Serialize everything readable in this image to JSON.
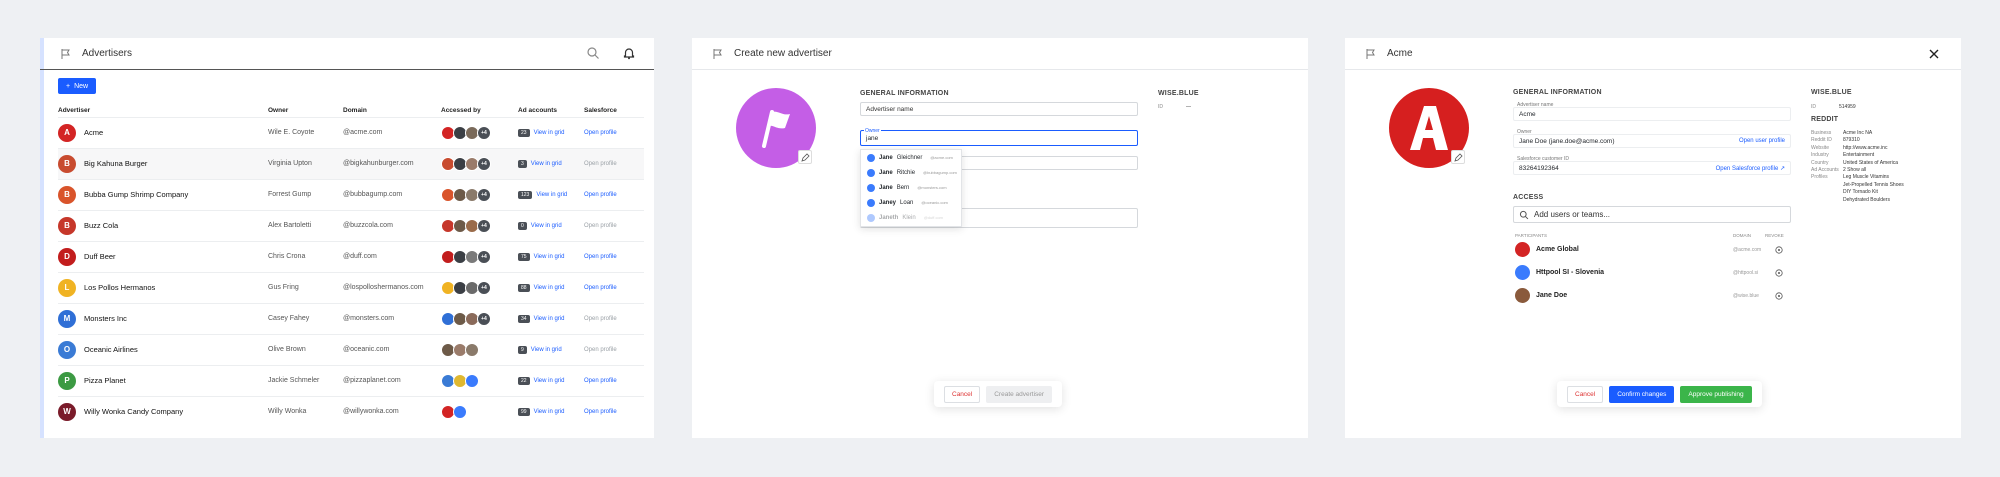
{
  "panel1": {
    "title": "Advertisers",
    "new_button": "New",
    "columns": [
      "Advertiser",
      "Owner",
      "Domain",
      "Accessed by",
      "Ad accounts",
      "Salesforce"
    ],
    "rows": [
      {
        "name": "Acme",
        "owner": "Wile E. Coyote",
        "domain": "@acme.com",
        "count": "23",
        "grid": "View in grid",
        "profile": "Open profile",
        "profile_active": true,
        "logo_color": "#d32424",
        "logo_letter": "A"
      },
      {
        "name": "Big Kahuna Burger",
        "owner": "Virginia Upton",
        "domain": "@bigkahunburger.com",
        "count": "3",
        "grid": "View in grid",
        "profile": "Open profile",
        "profile_active": false,
        "logo_color": "#c84b2f",
        "logo_letter": "B"
      },
      {
        "name": "Bubba Gump Shrimp Company",
        "owner": "Forrest Gump",
        "domain": "@bubbagump.com",
        "count": "123",
        "grid": "View in grid",
        "profile": "Open profile",
        "profile_active": true,
        "logo_color": "#d9542b",
        "logo_letter": "B"
      },
      {
        "name": "Buzz Cola",
        "owner": "Alex Bartoletti",
        "domain": "@buzzcola.com",
        "count": "0",
        "grid": "View in grid",
        "profile": "Open profile",
        "profile_active": false,
        "logo_color": "#c6372a",
        "logo_letter": "B"
      },
      {
        "name": "Duff Beer",
        "owner": "Chris Crona",
        "domain": "@duff.com",
        "count": "75",
        "grid": "View in grid",
        "profile": "Open profile",
        "profile_active": true,
        "logo_color": "#c21d1d",
        "logo_letter": "D"
      },
      {
        "name": "Los Pollos Hermanos",
        "owner": "Gus Fring",
        "domain": "@lospolloshermanos.com",
        "count": "88",
        "grid": "View in grid",
        "profile": "Open profile",
        "profile_active": true,
        "logo_color": "#f0b323",
        "logo_letter": "L"
      },
      {
        "name": "Monsters Inc",
        "owner": "Casey Fahey",
        "domain": "@monsters.com",
        "count": "34",
        "grid": "View in grid",
        "profile": "Open profile",
        "profile_active": false,
        "logo_color": "#2f6fd6",
        "logo_letter": "M"
      },
      {
        "name": "Oceanic Airlines",
        "owner": "Olive Brown",
        "domain": "@oceanic.com",
        "count": "9",
        "grid": "View in grid",
        "profile": "Open profile",
        "profile_active": false,
        "logo_color": "#3a7bd5",
        "logo_letter": "O"
      },
      {
        "name": "Pizza Planet",
        "owner": "Jackie Schmeler",
        "domain": "@pizzaplanet.com",
        "count": "22",
        "grid": "View in grid",
        "profile": "Open profile",
        "profile_active": true,
        "logo_color": "#3c9a43",
        "logo_letter": "P"
      },
      {
        "name": "Willy Wonka Candy Company",
        "owner": "Willy Wonka",
        "domain": "@willywonka.com",
        "count": "99",
        "grid": "View in grid",
        "profile": "Open profile",
        "profile_active": true,
        "logo_color": "#7a1b2a",
        "logo_letter": "W"
      }
    ],
    "more_badge": "+4"
  },
  "panel2": {
    "title": "Create new advertiser",
    "general_info": "GENERAL INFORMATION",
    "name_placeholder": "Advertiser name",
    "owner_label": "Owner",
    "owner_value": "jane",
    "dropdown": [
      {
        "first": "Jane",
        "last": "Gleichner",
        "email": "@acme.com"
      },
      {
        "first": "Jane",
        "last": "Ritchie",
        "email": "@bubbagump.com"
      },
      {
        "first": "Jane",
        "last": "Bern",
        "email": "@monsters.com"
      },
      {
        "first": "Janey",
        "last": "Loan",
        "email": "@oceanic.com"
      },
      {
        "first": "Janeth",
        "last": "Klein",
        "email": "@duff.com"
      }
    ],
    "wise_blue": "WISE.BLUE",
    "id_label": "ID",
    "id_value": "—",
    "cancel": "Cancel",
    "create": "Create advertiser",
    "ellipsis": "..."
  },
  "panel3": {
    "title": "Acme",
    "general_info": "GENERAL INFORMATION",
    "name_label": "Advertiser name",
    "name_value": "Acme",
    "owner_label": "Owner",
    "owner_value": "Jane Doe (jane.doe@acme.com)",
    "open_user_profile": "Open user profile",
    "sf_label": "Salesforce customer ID",
    "sf_value": "83264192364",
    "open_sf_profile": "Open Salesforce profile",
    "access": "ACCESS",
    "search_placeholder": "Add users or teams...",
    "col_participants": "PARTICIPANTS",
    "col_domain": "DOMAIN",
    "col_revoke": "REVOKE",
    "participants": [
      {
        "name": "Acme Global",
        "domain": "@acme.com",
        "color": "#d32424"
      },
      {
        "name": "Httpool SI - Slovenia",
        "domain": "@httpool.si",
        "color": "#3a7bfd"
      },
      {
        "name": "Jane Doe",
        "domain": "@wise.blue",
        "color": "#8a5a3c"
      }
    ],
    "wise_blue": "WISE.BLUE",
    "id_label": "ID",
    "id_value": "514959",
    "reddit": "REDDIT",
    "reddit_fields": [
      {
        "k": "Business",
        "v": "Acme Inc NA"
      },
      {
        "k": "Reddit ID",
        "v": "879310"
      },
      {
        "k": "Website",
        "v": "http://www.acme.inc"
      },
      {
        "k": "Industry",
        "v": "Entertainment"
      },
      {
        "k": "Country",
        "v": "United States of America"
      },
      {
        "k": "Ad Accounts",
        "v": "2  Show all"
      },
      {
        "k": "Profiles",
        "v": "Leg Muscle Vitamins"
      },
      {
        "k": "",
        "v": "Jet-Propelled Tennis Shoes"
      },
      {
        "k": "",
        "v": "DIY Tornado Kit"
      },
      {
        "k": "",
        "v": "Dehydrated Boulders"
      }
    ],
    "cancel": "Cancel",
    "confirm": "Confirm changes",
    "approve": "Approve publishing"
  }
}
